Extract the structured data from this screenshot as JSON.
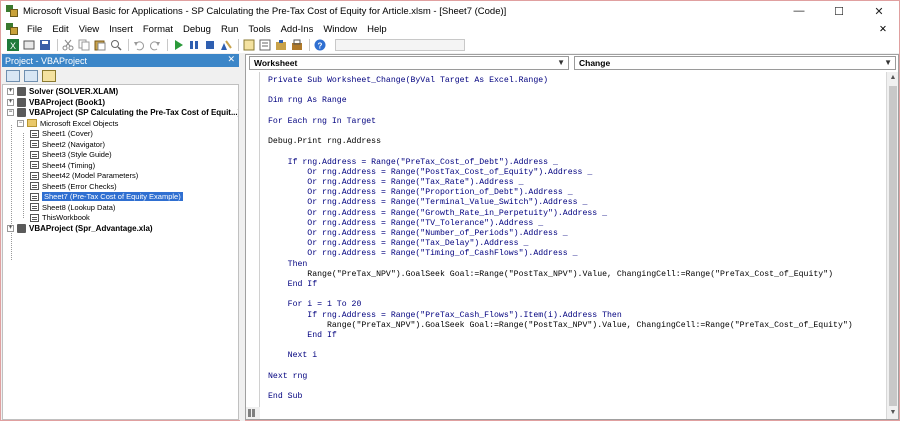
{
  "window": {
    "title": "Microsoft Visual Basic for Applications - SP Calculating the Pre-Tax Cost of Equity for Article.xlsm - [Sheet7 (Code)]",
    "minimize": "—",
    "maximize": "☐",
    "close": "✕"
  },
  "menubar": {
    "items": [
      "File",
      "Edit",
      "View",
      "Insert",
      "Format",
      "Debug",
      "Run",
      "Tools",
      "Add-Ins",
      "Window",
      "Help"
    ],
    "doc_close": "✕"
  },
  "toolbar": {
    "icons": [
      "excel-icon",
      "insert-icon",
      "save-icon",
      "cut-icon",
      "copy-icon",
      "paste-icon",
      "find-icon",
      "undo-icon",
      "redo-icon",
      "run-icon",
      "break-icon",
      "reset-icon",
      "design-mode-icon",
      "project-explorer-icon",
      "properties-icon",
      "object-browser-icon",
      "toolbox-icon",
      "help-icon"
    ]
  },
  "project_explorer": {
    "title": "Project - VBAProject",
    "close": "✕",
    "tree": [
      {
        "label": "Solver (SOLVER.XLAM)",
        "bold": true,
        "expander": "+"
      },
      {
        "label": "VBAProject (Book1)",
        "bold": true,
        "expander": "+"
      },
      {
        "label": "VBAProject (SP Calculating the Pre-Tax Cost of Equit...)",
        "bold": true,
        "expander": "−"
      },
      {
        "label": "Microsoft Excel Objects",
        "bold": false,
        "expander": "−"
      },
      {
        "label": "Sheet1 (Cover)",
        "bold": false
      },
      {
        "label": "Sheet2 (Navigator)",
        "bold": false
      },
      {
        "label": "Sheet3 (Style Guide)",
        "bold": false
      },
      {
        "label": "Sheet4 (Timing)",
        "bold": false
      },
      {
        "label": "Sheet42 (Model Parameters)",
        "bold": false
      },
      {
        "label": "Sheet5 (Error Checks)",
        "bold": false
      },
      {
        "label": "Sheet7 (Pre-Tax Cost of Equity Example)",
        "bold": false,
        "selected": true
      },
      {
        "label": "Sheet8 (Lookup Data)",
        "bold": false
      },
      {
        "label": "ThisWorkbook",
        "bold": false
      },
      {
        "label": "VBAProject (Spr_Advantage.xla)",
        "bold": true,
        "expander": "+"
      }
    ]
  },
  "code_window": {
    "object_combo": "Worksheet",
    "procedure_combo": "Change",
    "lines": [
      {
        "text": "Private Sub Worksheet_Change(ByVal Target As Excel.Range)",
        "kw": true
      },
      {
        "text": "",
        "kw": false
      },
      {
        "text": "Dim rng As Range",
        "kw": true
      },
      {
        "text": "",
        "kw": false
      },
      {
        "text": "For Each rng In Target",
        "kw": true
      },
      {
        "text": "",
        "kw": false
      },
      {
        "text": "Debug.Print rng.Address",
        "kw": false
      },
      {
        "text": "",
        "kw": false
      },
      {
        "text": "    If rng.Address = Range(\"PreTax_Cost_of_Debt\").Address _",
        "kw": true
      },
      {
        "text": "        Or rng.Address = Range(\"PostTax_Cost_of_Equity\").Address _",
        "kw": true
      },
      {
        "text": "        Or rng.Address = Range(\"Tax_Rate\").Address _",
        "kw": true
      },
      {
        "text": "        Or rng.Address = Range(\"Proportion_of_Debt\").Address _",
        "kw": true
      },
      {
        "text": "        Or rng.Address = Range(\"Terminal_Value_Switch\").Address _",
        "kw": true
      },
      {
        "text": "        Or rng.Address = Range(\"Growth_Rate_in_Perpetuity\").Address _",
        "kw": true
      },
      {
        "text": "        Or rng.Address = Range(\"TV_Tolerance\").Address _",
        "kw": true
      },
      {
        "text": "        Or rng.Address = Range(\"Number_of_Periods\").Address _",
        "kw": true
      },
      {
        "text": "        Or rng.Address = Range(\"Tax_Delay\").Address _",
        "kw": true
      },
      {
        "text": "        Or rng.Address = Range(\"Timing_of_CashFlows\").Address _",
        "kw": true
      },
      {
        "text": "    Then",
        "kw": true
      },
      {
        "text": "        Range(\"PreTax_NPV\").GoalSeek Goal:=Range(\"PostTax_NPV\").Value, ChangingCell:=Range(\"PreTax_Cost_of_Equity\")",
        "kw": false
      },
      {
        "text": "    End If",
        "kw": true
      },
      {
        "text": "",
        "kw": false
      },
      {
        "text": "    For i = 1 To 20",
        "kw": true
      },
      {
        "text": "        If rng.Address = Range(\"PreTax_Cash_Flows\").Item(i).Address Then",
        "kw": true
      },
      {
        "text": "            Range(\"PreTax_NPV\").GoalSeek Goal:=Range(\"PostTax_NPV\").Value, ChangingCell:=Range(\"PreTax_Cost_of_Equity\")",
        "kw": false
      },
      {
        "text": "        End If",
        "kw": true
      },
      {
        "text": "",
        "kw": false
      },
      {
        "text": "    Next i",
        "kw": true
      },
      {
        "text": "",
        "kw": false
      },
      {
        "text": "Next rng",
        "kw": true
      },
      {
        "text": "",
        "kw": false
      },
      {
        "text": "End Sub",
        "kw": true
      }
    ],
    "colors": {
      "keyword": "#00007f",
      "text": "#000000"
    }
  }
}
